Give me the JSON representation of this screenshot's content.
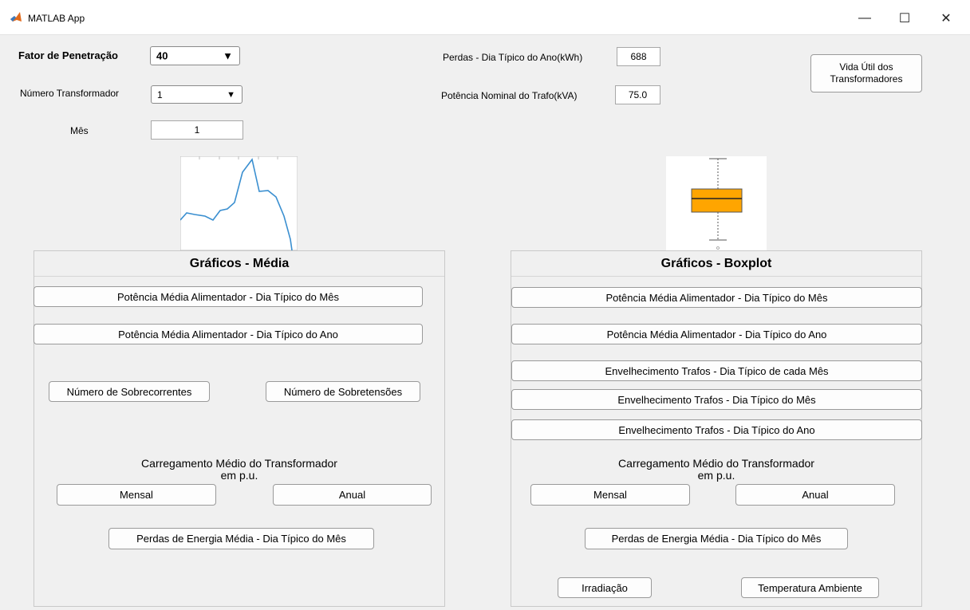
{
  "window": {
    "title": "MATLAB App",
    "minimize": "—",
    "maximize": "☐",
    "close": "✕"
  },
  "controls": {
    "fator_label": "Fator de Penetração",
    "fator_value": "40",
    "transformador_label": "Número Transformador",
    "transformador_value": "1",
    "mes_label": "Mês",
    "mes_value": "1",
    "perdas_label": "Perdas - Dia Típico do Ano(kWh)",
    "perdas_value": "688",
    "potencia_label": "Potência Nominal do Trafo(kVA)",
    "potencia_value": "75.0",
    "vida_util_line1": "Vida Útil dos",
    "vida_util_line2": "Transformadores"
  },
  "panel_media": {
    "title": "Gráficos - Média",
    "btn_pot_mes": "Potência Média Alimentador - Dia Típico do Mês",
    "btn_pot_ano": "Potência Média Alimentador - Dia Típico do Ano",
    "btn_sobrecorrentes": "Número de Sobrecorrentes",
    "btn_sobretensoes": "Número de Sobretensões",
    "carregamento_line1": "Carregamento Médio do Transformador",
    "carregamento_line2": "em p.u.",
    "btn_mensal": "Mensal",
    "btn_anual": "Anual",
    "btn_perdas": "Perdas de Energia Média - Dia Típico do Mês"
  },
  "panel_boxplot": {
    "title": "Gráficos - Boxplot",
    "btn_pot_mes": "Potência Média Alimentador - Dia Típico do Mês",
    "btn_pot_ano": "Potência Média Alimentador - Dia Típico do Ano",
    "btn_env_cada_mes": "Envelhecimento Trafos - Dia Típico de cada Mês",
    "btn_env_mes": "Envelhecimento Trafos - Dia Típico do Mês",
    "btn_env_ano": "Envelhecimento Trafos - Dia Típico do Ano",
    "carregamento_line1": "Carregamento Médio do Transformador",
    "carregamento_line2": "em p.u.",
    "btn_mensal": "Mensal",
    "btn_anual": "Anual",
    "btn_perdas": "Perdas de Energia Média - Dia Típico do Mês",
    "btn_irradiacao": "Irradiação",
    "btn_temperatura": "Temperatura Ambiente"
  },
  "colors": {
    "line": "#3a8fd0",
    "box": "#ffa500"
  }
}
